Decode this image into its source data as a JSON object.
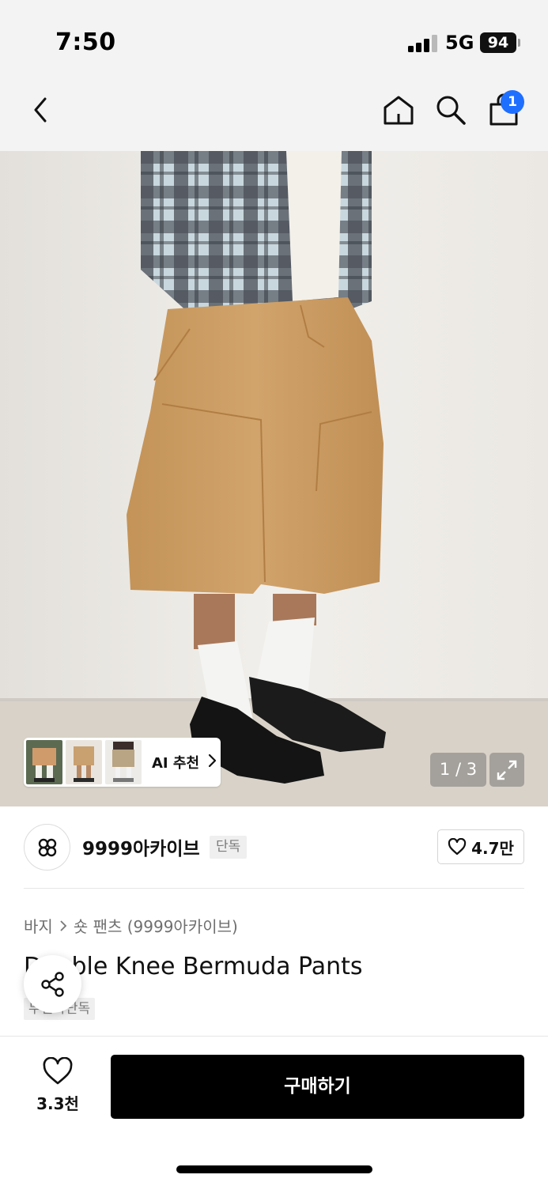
{
  "status_bar": {
    "time": "7:50",
    "network": "5G",
    "battery": "94",
    "signal_bars_active": 3,
    "signal_bars_total": 4
  },
  "nav": {
    "back_icon": "chevron-left-icon",
    "home_icon": "home-icon",
    "search_icon": "search-icon",
    "cart_icon": "shopping-bag-icon",
    "cart_count": "1"
  },
  "gallery": {
    "ai_recommend_label": "AI 추천",
    "page_indicator": "1 / 3",
    "expand_icon": "expand-icon"
  },
  "brand": {
    "name": "9999아카이브",
    "badge": "단독",
    "like_count": "4.7만"
  },
  "product": {
    "breadcrumb": [
      "바지",
      "숏 팬츠 (9999아카이브)"
    ],
    "title": "Double Knee Bermuda Pants",
    "tag": "무신사단독"
  },
  "bottom_bar": {
    "wish_count": "3.3천",
    "buy_label": "구매하기"
  },
  "colors": {
    "accent_badge": "#1f6fff",
    "pants": "#c99a63",
    "buy_button": "#000000"
  }
}
